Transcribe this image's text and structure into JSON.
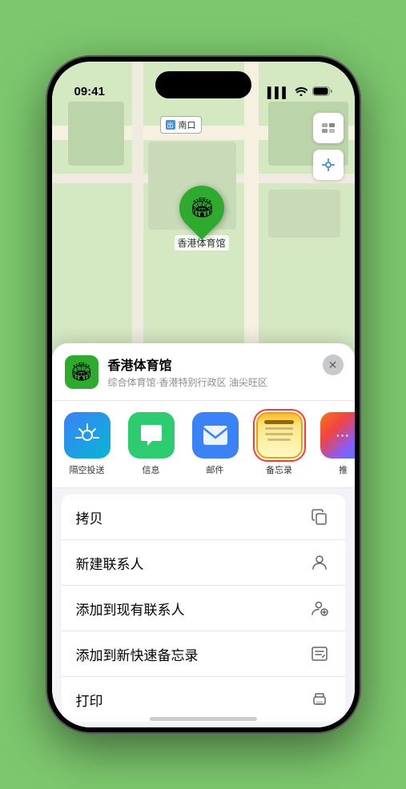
{
  "status_bar": {
    "time": "09:41",
    "signal_icon": "▌▌▌",
    "wifi_icon": "wifi",
    "battery_icon": "🔋"
  },
  "map": {
    "label_text": "南口",
    "pin_emoji": "🏟",
    "pin_label": "香港体育馆",
    "map_icon": "🗺",
    "location_icon": "⬆"
  },
  "location_header": {
    "name": "香港体育馆",
    "sub": "综合体育馆·香港特别行政区 油尖旺区",
    "icon_emoji": "🏟",
    "close_label": "✕"
  },
  "share_apps": [
    {
      "id": "airdrop",
      "label": "隔空投送",
      "emoji": "📡"
    },
    {
      "id": "messages",
      "label": "信息",
      "emoji": "💬"
    },
    {
      "id": "mail",
      "label": "邮件",
      "emoji": "✉️"
    },
    {
      "id": "notes",
      "label": "备忘录",
      "emoji": "📝",
      "selected": true
    },
    {
      "id": "more",
      "label": "推",
      "emoji": "⋯"
    }
  ],
  "actions": [
    {
      "label": "拷贝",
      "icon": "📋"
    },
    {
      "label": "新建联系人",
      "icon": "👤"
    },
    {
      "label": "添加到现有联系人",
      "icon": "👤+"
    },
    {
      "label": "添加到新快速备忘录",
      "icon": "🖼"
    },
    {
      "label": "打印",
      "icon": "🖨"
    }
  ]
}
